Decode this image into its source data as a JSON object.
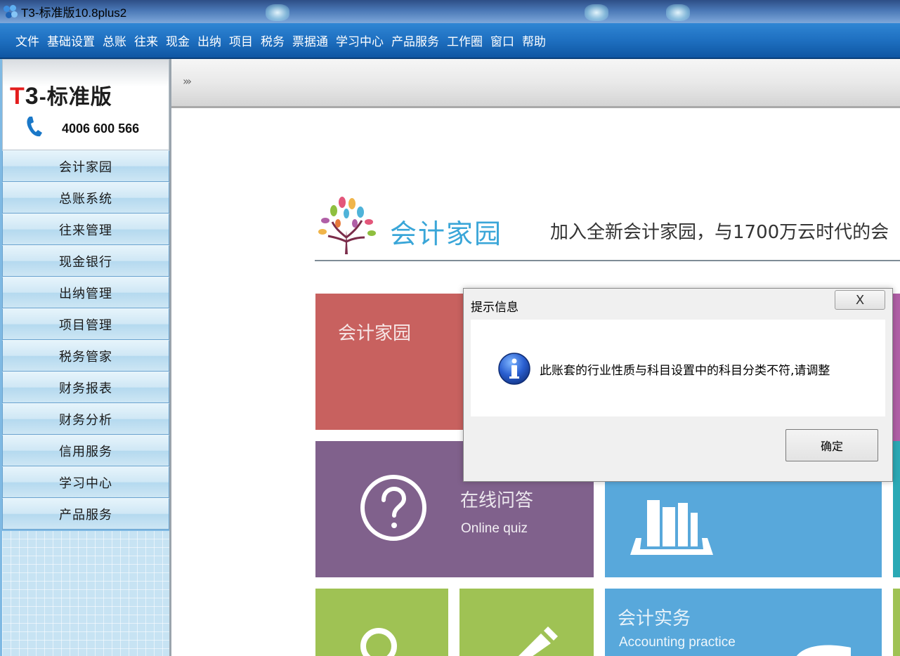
{
  "window": {
    "title": "T3-标准版10.8plus2"
  },
  "menu": [
    "文件",
    "基础设置",
    "总账",
    "往来",
    "现金",
    "出纳",
    "项目",
    "税务",
    "票据通",
    "学习中心",
    "产品服务",
    "工作圈",
    "窗口",
    "帮助"
  ],
  "sidebar": {
    "logo": {
      "t": "T",
      "three": "3",
      "rest": "-标准版"
    },
    "phone": "4006 600 566",
    "items": [
      "会计家园",
      "总账系统",
      "往来管理",
      "现金银行",
      "出纳管理",
      "项目管理",
      "税务管家",
      "财务报表",
      "财务分析",
      "信用服务",
      "学习中心",
      "产品服务"
    ]
  },
  "toolbar": {
    "chevrons": "›››"
  },
  "home": {
    "title": "会计家园",
    "slogan": "加入全新会计家园，与1700万云时代的会",
    "tiles": {
      "t1": {
        "title": "会计家园",
        "color": "#c8615f"
      },
      "t2": {
        "color": "#efb06c"
      },
      "t3": {
        "title": "在线问答",
        "subtitle": "Online quiz",
        "color": "#80618c"
      },
      "t4": {
        "color": "#58a8db"
      },
      "t5": {
        "title": "会计实务",
        "subtitle": "Accounting practice",
        "color": "#58a8db"
      },
      "t6": {
        "color": "#9fc254"
      }
    }
  },
  "dialog": {
    "title": "提示信息",
    "close_label": "X",
    "message": "此账套的行业性质与科目设置中的科目分类不符,请调整",
    "ok_label": "确定"
  }
}
